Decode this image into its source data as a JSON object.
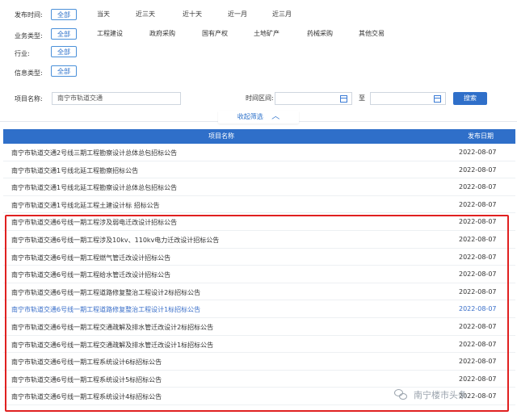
{
  "filters": {
    "publish_time": {
      "label": "发布时间:",
      "options": [
        "全部",
        "当天",
        "近三天",
        "近十天",
        "近一月",
        "近三月"
      ]
    },
    "business_type": {
      "label": "业务类型:",
      "options": [
        "全部",
        "工程建设",
        "政府采购",
        "国有产权",
        "土地矿产",
        "药械采购",
        "其他交易"
      ]
    },
    "industry": {
      "label": "行业:",
      "options": [
        "全部"
      ]
    },
    "info_type": {
      "label": "信息类型:",
      "options": [
        "全部"
      ]
    },
    "project_name": {
      "label": "项目名称:",
      "value": "南宁市轨道交通"
    },
    "time_range": {
      "label": "时间区间:",
      "to": "至",
      "start": "",
      "end": ""
    },
    "search_label": "搜索",
    "collapse_label": "收起筛选"
  },
  "table": {
    "headers": {
      "name": "项目名称",
      "date": "发布日期"
    },
    "rows": [
      {
        "name": "南宁市轨道交通2号线三期工程勘察设计总体总包招标公告",
        "date": "2022-08-07"
      },
      {
        "name": "南宁市轨道交通1号线北延工程勘察招标公告",
        "date": "2022-08-07"
      },
      {
        "name": "南宁市轨道交通1号线北延工程勘察设计总体总包招标公告",
        "date": "2022-08-07"
      },
      {
        "name": "南宁市轨道交通1号线北延工程土建设计标 招标公告",
        "date": "2022-08-07"
      },
      {
        "name": "南宁市轨道交通6号线一期工程涉及弱电迁改设计招标公告",
        "date": "2022-08-07"
      },
      {
        "name": "南宁市轨道交通6号线一期工程涉及10kv、110kv电力迁改设计招标公告",
        "date": "2022-08-07"
      },
      {
        "name": "南宁市轨道交通6号线一期工程燃气管迁改设计招标公告",
        "date": "2022-08-07"
      },
      {
        "name": "南宁市轨道交通6号线一期工程给水管迁改设计招标公告",
        "date": "2022-08-07"
      },
      {
        "name": "南宁市轨道交通6号线一期工程道路修复整治工程设计2标招标公告",
        "date": "2022-08-07"
      },
      {
        "name": "南宁市轨道交通6号线一期工程道路修复整治工程设计1标招标公告",
        "date": "2022-08-07"
      },
      {
        "name": "南宁市轨道交通6号线一期工程交通疏解及排水管迁改设计2标招标公告",
        "date": "2022-08-07"
      },
      {
        "name": "南宁市轨道交通6号线一期工程交通疏解及排水管迁改设计1标招标公告",
        "date": "2022-08-07"
      },
      {
        "name": "南宁市轨道交通6号线一期工程系统设计6标招标公告",
        "date": "2022-08-07"
      },
      {
        "name": "南宁市轨道交通6号线一期工程系统设计5标招标公告",
        "date": "2022-08-07"
      },
      {
        "name": "南宁市轨道交通6号线一期工程系统设计4标招标公告",
        "date": "2022-08-07"
      }
    ]
  },
  "watermark": "南宁楼市头条",
  "colors": {
    "accent": "#2f6fc9",
    "highlight_border": "#e02020",
    "link_row": "#3a6fc9"
  }
}
